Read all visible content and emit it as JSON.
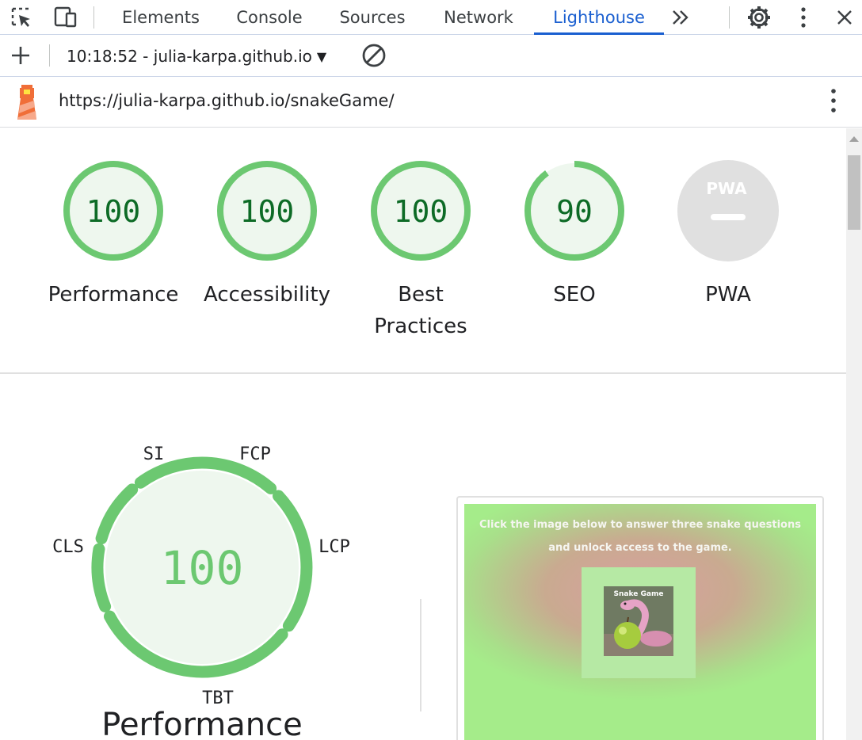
{
  "devtools": {
    "tabs": [
      {
        "label": "Elements"
      },
      {
        "label": "Console"
      },
      {
        "label": "Sources"
      },
      {
        "label": "Network"
      },
      {
        "label": "Lighthouse",
        "active": true
      }
    ],
    "icons": [
      "inspect-element-icon",
      "device-toolbar-icon",
      "more-tabs-icon",
      "settings-gear-icon",
      "more-options-icon",
      "close-icon"
    ],
    "accent_color": "#1a5fd0"
  },
  "toolbar": {
    "report_label": "10:18:52 - julia-karpa.github.io",
    "icons": [
      "add-icon",
      "dropdown-caret-icon",
      "clear-icon"
    ]
  },
  "urlbar": {
    "url": "https://julia-karpa.github.io/snakeGame/",
    "icons": [
      "lighthouse-logo-icon",
      "kebab-menu-icon"
    ]
  },
  "scores": [
    {
      "category": "Performance",
      "score": "100",
      "fraction": 1.0
    },
    {
      "category": "Accessibility",
      "score": "100",
      "fraction": 1.0
    },
    {
      "category": "Best Practices",
      "score": "100",
      "fraction": 1.0
    },
    {
      "category": "SEO",
      "score": "90",
      "fraction": 0.9
    },
    {
      "category": "PWA",
      "score": "",
      "badge": "PWA",
      "fraction": null
    }
  ],
  "colors": {
    "pass": "#0cce6b",
    "pass_ring": "#6cc871",
    "pass_text": "#0d6b26",
    "pass_bg": "#eef7ee",
    "neutral": "#e0e0e0"
  },
  "performance": {
    "score": "100",
    "title": "Performance",
    "metrics": [
      "SI",
      "FCP",
      "LCP",
      "TBT",
      "CLS"
    ]
  },
  "screenshot": {
    "banner": "Click the image below to answer three snake questions and unlock access to the game.",
    "image_title": "Snake Game"
  }
}
